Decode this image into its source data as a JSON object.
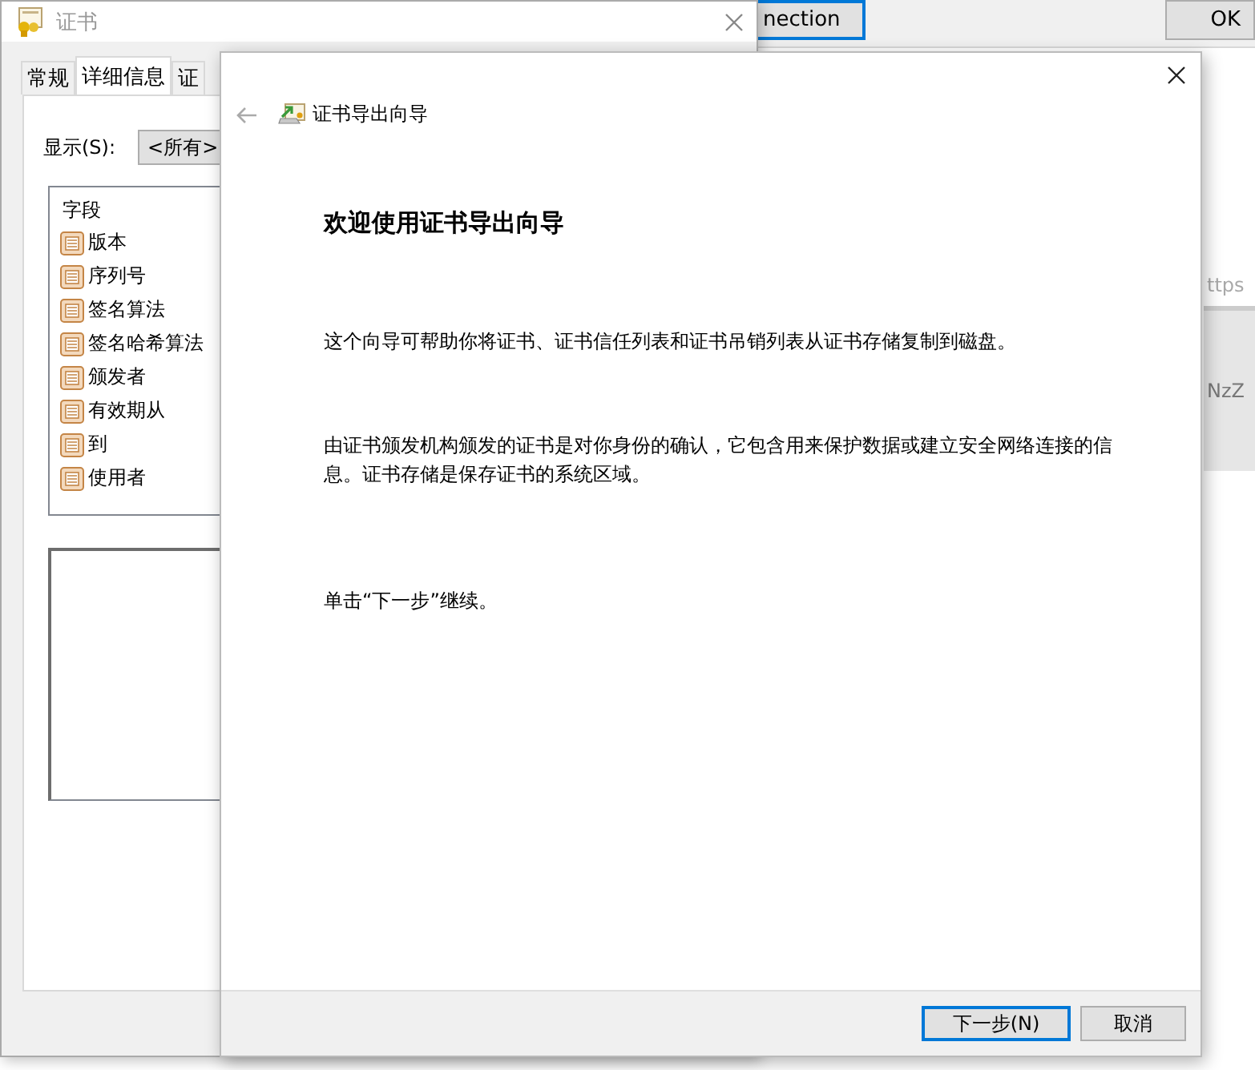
{
  "background_app": {
    "buttons": [
      {
        "label": "nection",
        "focused": true
      },
      {
        "label": "OK",
        "focused": false
      }
    ],
    "texts": [
      "ttps",
      "NzZ"
    ]
  },
  "certificate_window": {
    "title": "证书",
    "tabs": [
      {
        "label": "常规",
        "selected": false
      },
      {
        "label": "详细信息",
        "selected": true
      },
      {
        "label": "证",
        "selected": false
      }
    ],
    "show_label": "显示(S):",
    "show_value": "<所有>",
    "fields_header": "字段",
    "fields": [
      "版本",
      "序列号",
      "签名算法",
      "签名哈希算法",
      "颁发者",
      "有效期从",
      "到",
      "使用者"
    ]
  },
  "wizard": {
    "title": "证书导出向导",
    "heading": "欢迎使用证书导出向导",
    "paragraphs": [
      "这个向导可帮助你将证书、证书信任列表和证书吊销列表从证书存储复制到磁盘。",
      "由证书颁发机构颁发的证书是对你身份的确认，它包含用来保护数据或建立安全网络连接的信息。证书存储是保存证书的系统区域。",
      "单击“下一步”继续。"
    ],
    "buttons": [
      {
        "label": "下一步(N)",
        "default": true
      },
      {
        "label": "取消",
        "default": false
      }
    ]
  }
}
